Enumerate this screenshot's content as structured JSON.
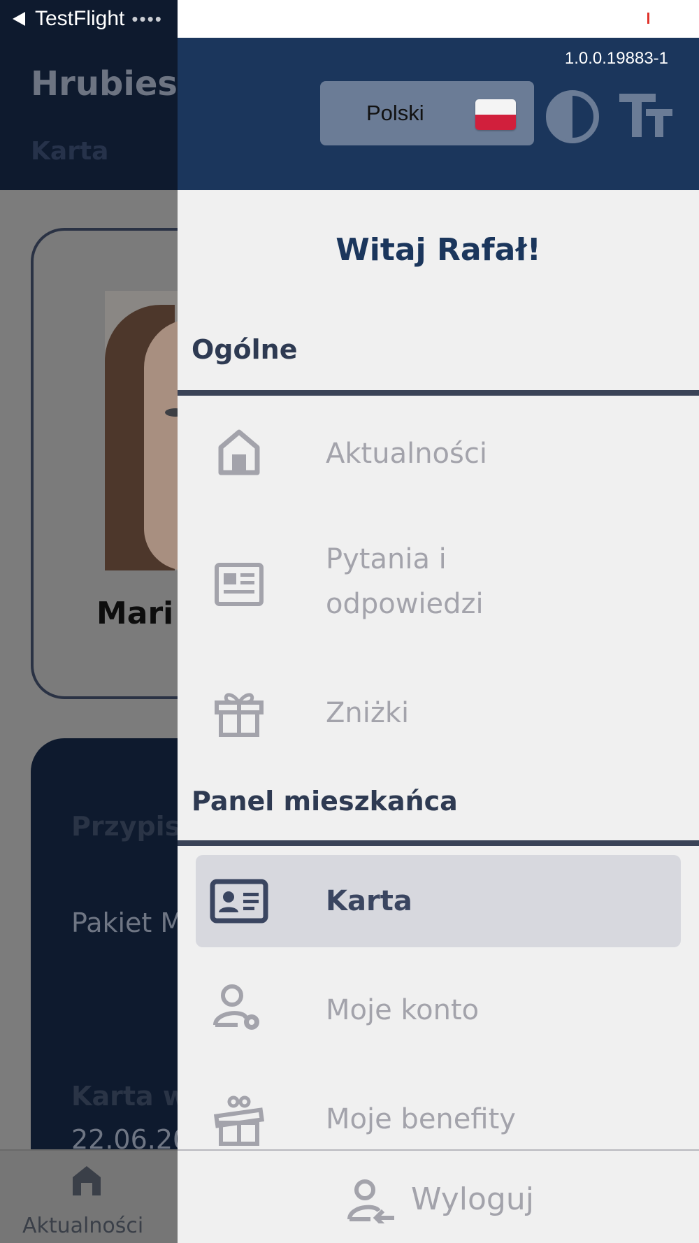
{
  "status_bar": {
    "back_app": "TestFlight"
  },
  "background": {
    "title": "Hrubiesz",
    "subtitle": "Karta",
    "card_name": "Mari",
    "card2_label": "Przypis",
    "card2_value": "Pakiet M",
    "card2_label2": "Karta w",
    "card2_date": "22.06.20",
    "tab_label": "Aktualności"
  },
  "drawer": {
    "version": "1.0.0.19883-1",
    "language": "Polski",
    "greeting": "Witaj Rafał!",
    "sections": {
      "general": "Ogólne",
      "resident": "Panel mieszkańca"
    },
    "items": {
      "news": "Aktualności",
      "faq_line1": "Pytania i",
      "faq_line2": "odpowiedzi",
      "discounts": "Zniżki",
      "card": "Karta",
      "account": "Moje konto",
      "benefits": "Moje benefity"
    },
    "logout": "Wyloguj"
  },
  "colors": {
    "header_navy": "#1b365c",
    "accent_text": "#1b365c",
    "inactive_text": "#a3a3ab",
    "active_bg": "#d7d8de"
  },
  "icons": {
    "news": "home-icon",
    "faq": "newspaper-icon",
    "discounts": "gift-icon",
    "card": "id-card-icon",
    "account": "user-gear-icon",
    "benefits": "gift-open-icon",
    "logout": "user-logout-icon",
    "contrast": "contrast-icon",
    "textsize": "text-size-icon"
  }
}
